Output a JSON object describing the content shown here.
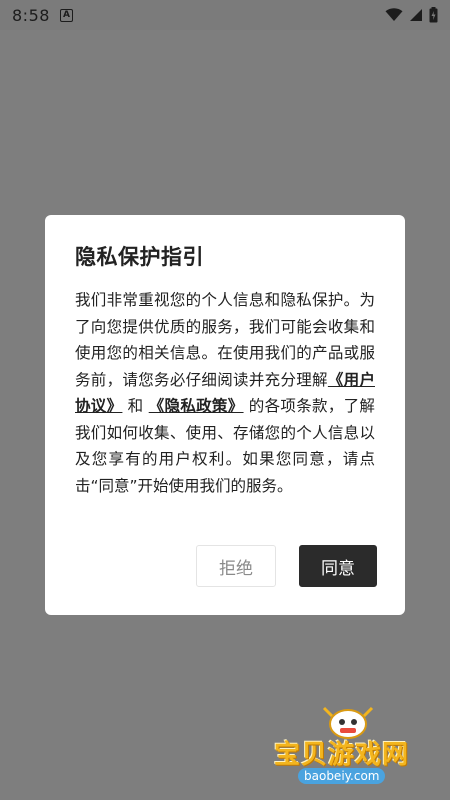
{
  "status_bar": {
    "time": "8:58",
    "notification_icon": "a-icon",
    "icons": [
      "wifi-icon",
      "signal-icon",
      "battery-icon"
    ]
  },
  "dialog": {
    "title": "隐私保护指引",
    "body_part1": "我们非常重视您的个人信息和隐私保护。为了向您提供优质的服务，我们可能会收集和使用您的相关信息。在使用我们的产品或服务前，请您务必仔细阅读并充分理解",
    "link_user_agreement": "《用户协议》",
    "body_and": "和",
    "link_privacy_policy": "《隐私政策》",
    "body_part2": "的各项条款，了解我们如何收集、使用、存储您的个人信息以及您享有的用户权利。如果您同意，请点击“同意”开始使用我们的服务。",
    "refuse_label": "拒绝",
    "agree_label": "同意"
  },
  "watermark": {
    "brand": "宝贝游戏网",
    "url": "baobeiy.com"
  },
  "colors": {
    "backdrop": "#7e7e7e",
    "dialog_bg": "#ffffff",
    "agree_bg": "#2b2b2b",
    "refuse_text": "#8a8a8a",
    "watermark_gold": "#f3b51e"
  }
}
